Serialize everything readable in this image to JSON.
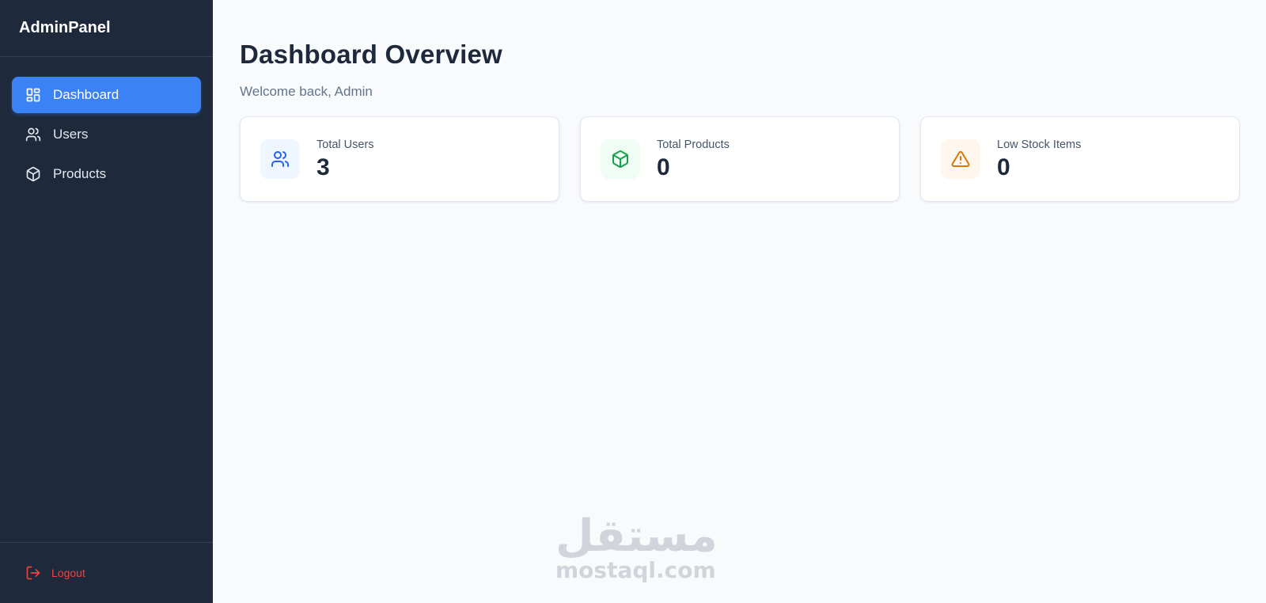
{
  "sidebar": {
    "brand": "AdminPanel",
    "items": [
      {
        "label": "Dashboard",
        "icon": "dashboard-grid-icon",
        "active": true
      },
      {
        "label": "Users",
        "icon": "users-icon",
        "active": false
      },
      {
        "label": "Products",
        "icon": "package-icon",
        "active": false
      }
    ],
    "logout_label": "Logout",
    "logout_icon": "logout-icon"
  },
  "main": {
    "title": "Dashboard Overview",
    "subtitle": "Welcome back, Admin",
    "cards": [
      {
        "label": "Total Users",
        "value": "3",
        "icon": "users-icon",
        "accent": "#2563eb",
        "badge_bg": "#eff6ff"
      },
      {
        "label": "Total Products",
        "value": "0",
        "icon": "package-icon",
        "accent": "#16a34a",
        "badge_bg": "#f0fdf4"
      },
      {
        "label": "Low Stock Items",
        "value": "0",
        "icon": "warning-triangle-icon",
        "accent": "#d97706",
        "badge_bg": "#fff7ed"
      }
    ]
  },
  "watermark": {
    "arabic": "مستقل",
    "latin": "mostaql.com"
  },
  "colors": {
    "sidebar_bg": "#1e293b",
    "active_item_bg": "#3b82f6",
    "logout": "#ef4444",
    "page_bg": "#f8fafc"
  }
}
